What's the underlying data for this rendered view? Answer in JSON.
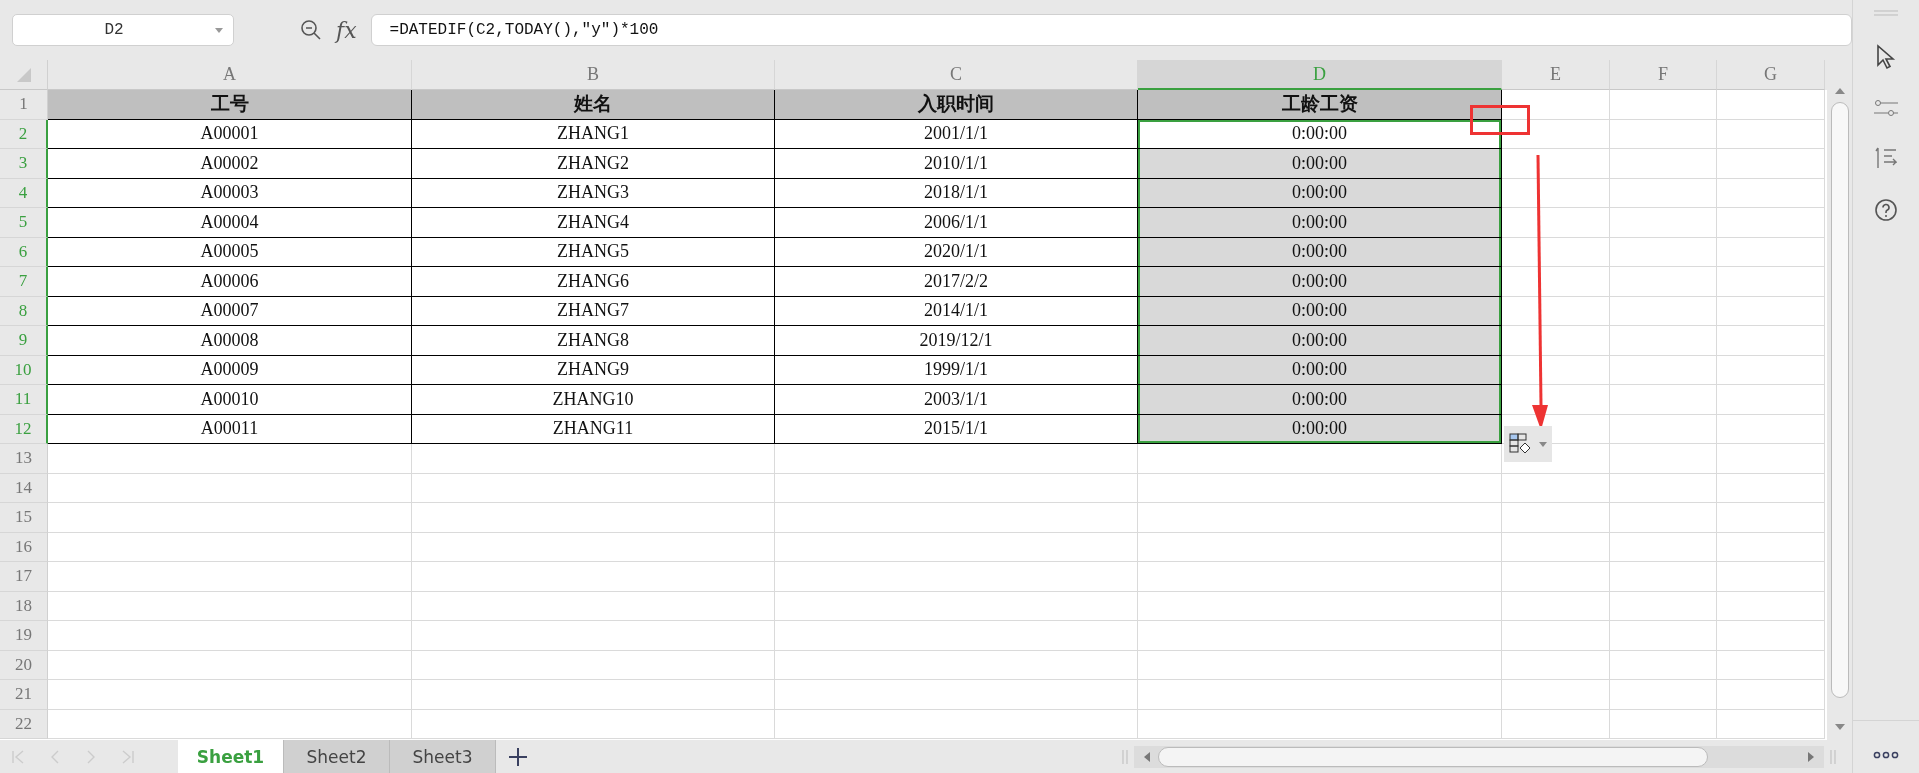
{
  "name_box": {
    "value": "D2"
  },
  "fx_label": "fx",
  "formula_bar": {
    "value": "=DATEDIF(C2,TODAY(),″y″)*100"
  },
  "columns": [
    {
      "label": "A",
      "selected": false
    },
    {
      "label": "B",
      "selected": false
    },
    {
      "label": "C",
      "selected": false
    },
    {
      "label": "D",
      "selected": true
    },
    {
      "label": "E",
      "selected": false
    },
    {
      "label": "F",
      "selected": false
    },
    {
      "label": "G",
      "selected": false
    }
  ],
  "rows": [
    {
      "label": "1",
      "kind": "header",
      "selected": false,
      "cells": [
        "工号",
        "姓名",
        "入职时间",
        "工龄工资"
      ]
    },
    {
      "label": "2",
      "kind": "data",
      "selected": true,
      "active": true,
      "cells": [
        "A00001",
        "ZHANG1",
        "2001/1/1",
        "0:00:00"
      ]
    },
    {
      "label": "3",
      "kind": "data",
      "selected": true,
      "active": false,
      "cells": [
        "A00002",
        "ZHANG2",
        "2010/1/1",
        "0:00:00"
      ]
    },
    {
      "label": "4",
      "kind": "data",
      "selected": true,
      "active": false,
      "cells": [
        "A00003",
        "ZHANG3",
        "2018/1/1",
        "0:00:00"
      ]
    },
    {
      "label": "5",
      "kind": "data",
      "selected": true,
      "active": false,
      "cells": [
        "A00004",
        "ZHANG4",
        "2006/1/1",
        "0:00:00"
      ]
    },
    {
      "label": "6",
      "kind": "data",
      "selected": true,
      "active": false,
      "cells": [
        "A00005",
        "ZHANG5",
        "2020/1/1",
        "0:00:00"
      ]
    },
    {
      "label": "7",
      "kind": "data",
      "selected": true,
      "active": false,
      "cells": [
        "A00006",
        "ZHANG6",
        "2017/2/2",
        "0:00:00"
      ]
    },
    {
      "label": "8",
      "kind": "data",
      "selected": true,
      "active": false,
      "cells": [
        "A00007",
        "ZHANG7",
        "2014/1/1",
        "0:00:00"
      ]
    },
    {
      "label": "9",
      "kind": "data",
      "selected": true,
      "active": false,
      "cells": [
        "A00008",
        "ZHANG8",
        "2019/12/1",
        "0:00:00"
      ]
    },
    {
      "label": "10",
      "kind": "data",
      "selected": true,
      "active": false,
      "cells": [
        "A00009",
        "ZHANG9",
        "1999/1/1",
        "0:00:00"
      ]
    },
    {
      "label": "11",
      "kind": "data",
      "selected": true,
      "active": false,
      "cells": [
        "A00010",
        "ZHANG10",
        "2003/1/1",
        "0:00:00"
      ]
    },
    {
      "label": "12",
      "kind": "data",
      "selected": true,
      "active": false,
      "cells": [
        "A00011",
        "ZHANG11",
        "2015/1/1",
        "0:00:00"
      ]
    },
    {
      "label": "13",
      "kind": "empty",
      "selected": false
    },
    {
      "label": "14",
      "kind": "empty",
      "selected": false
    },
    {
      "label": "15",
      "kind": "empty",
      "selected": false
    },
    {
      "label": "16",
      "kind": "empty",
      "selected": false
    },
    {
      "label": "17",
      "kind": "empty",
      "selected": false
    },
    {
      "label": "18",
      "kind": "empty",
      "selected": false
    },
    {
      "label": "19",
      "kind": "empty",
      "selected": false
    },
    {
      "label": "20",
      "kind": "empty",
      "selected": false
    },
    {
      "label": "21",
      "kind": "empty",
      "selected": false
    },
    {
      "label": "22",
      "kind": "empty",
      "selected": false
    }
  ],
  "sheet_tabs": [
    {
      "label": "Sheet1",
      "selected": true
    },
    {
      "label": "Sheet2",
      "selected": false
    },
    {
      "label": "Sheet3",
      "selected": false
    }
  ]
}
